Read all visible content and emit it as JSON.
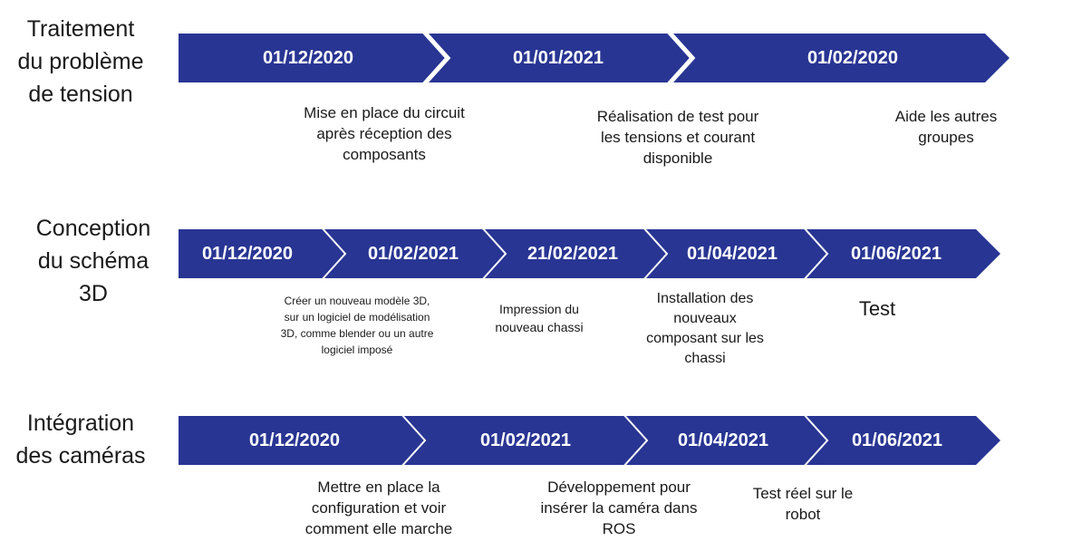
{
  "colors": {
    "arrow_fill": "#283593",
    "separator": "#ffffff",
    "text": "#1a1a1a"
  },
  "rows": [
    {
      "title": "Traitement\ndu problème\nde tension",
      "dates": [
        "01/12/2020",
        "01/01/2021",
        "01/02/2020"
      ],
      "descriptions": [
        "Mise en place du circuit\naprès réception des\ncomposants",
        "Réalisation de test pour\nles tensions et courant\ndisponible",
        "Aide les autres\ngroupes"
      ]
    },
    {
      "title": "Conception\ndu schéma\n3D",
      "dates": [
        "01/12/2020",
        "01/02/2021",
        "21/02/2021",
        "01/04/2021",
        "01/06/2021"
      ],
      "descriptions": [
        "Créer un nouveau modèle 3D,\nsur un logiciel de modélisation\n3D, comme blender ou un autre\nlogiciel imposé",
        "Impression du\nnouveau chassi",
        "Installation des\nnouveaux\ncomposant sur les\nchassi",
        "Test"
      ]
    },
    {
      "title": "Intégration\ndes caméras",
      "dates": [
        "01/12/2020",
        "01/02/2021",
        "01/04/2021",
        "01/06/2021"
      ],
      "descriptions": [
        "Mettre en place la\nconfiguration et voir\ncomment elle marche",
        "Développement pour\ninsérer la caméra dans\nROS",
        "Test réel sur le\nrobot"
      ]
    }
  ]
}
